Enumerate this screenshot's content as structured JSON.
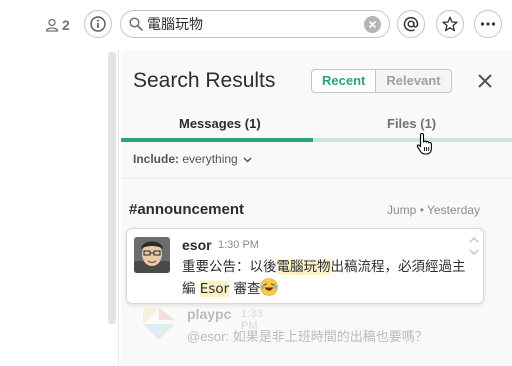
{
  "header": {
    "member_count": "2",
    "search_query": "電腦玩物"
  },
  "pane": {
    "title": "Search Results",
    "sort_recent": "Recent",
    "sort_relevant": "Relevant",
    "tab_messages": "Messages (1)",
    "tab_files": "Files (1)",
    "include_label": "Include:",
    "include_value": "everything"
  },
  "result": {
    "channel": "#announcement",
    "jump": "Jump",
    "dot": "•",
    "date": "Yesterday",
    "author": "esor",
    "time": "1:30 PM",
    "text_1": "重要公告：以後",
    "text_hl_1": "電腦玩物",
    "text_2": "出稿流程，必須經過主編 ",
    "text_hl_2": "Esor",
    "text_3": " 審查"
  },
  "ghost_result": {
    "author": "playpc",
    "time": "1:33 PM",
    "text": "@esor: 如果是非上班時間的出稿也要嗎？"
  },
  "colors": {
    "accent_green": "#2ba672",
    "highlight": "#fbf2c4"
  },
  "icons": [
    "person-icon",
    "info-icon",
    "search-icon",
    "clear-icon",
    "mention-icon",
    "star-icon",
    "more-icon",
    "close-icon",
    "chevron-down-icon",
    "hand-cursor-icon",
    "laughing-emoji"
  ]
}
